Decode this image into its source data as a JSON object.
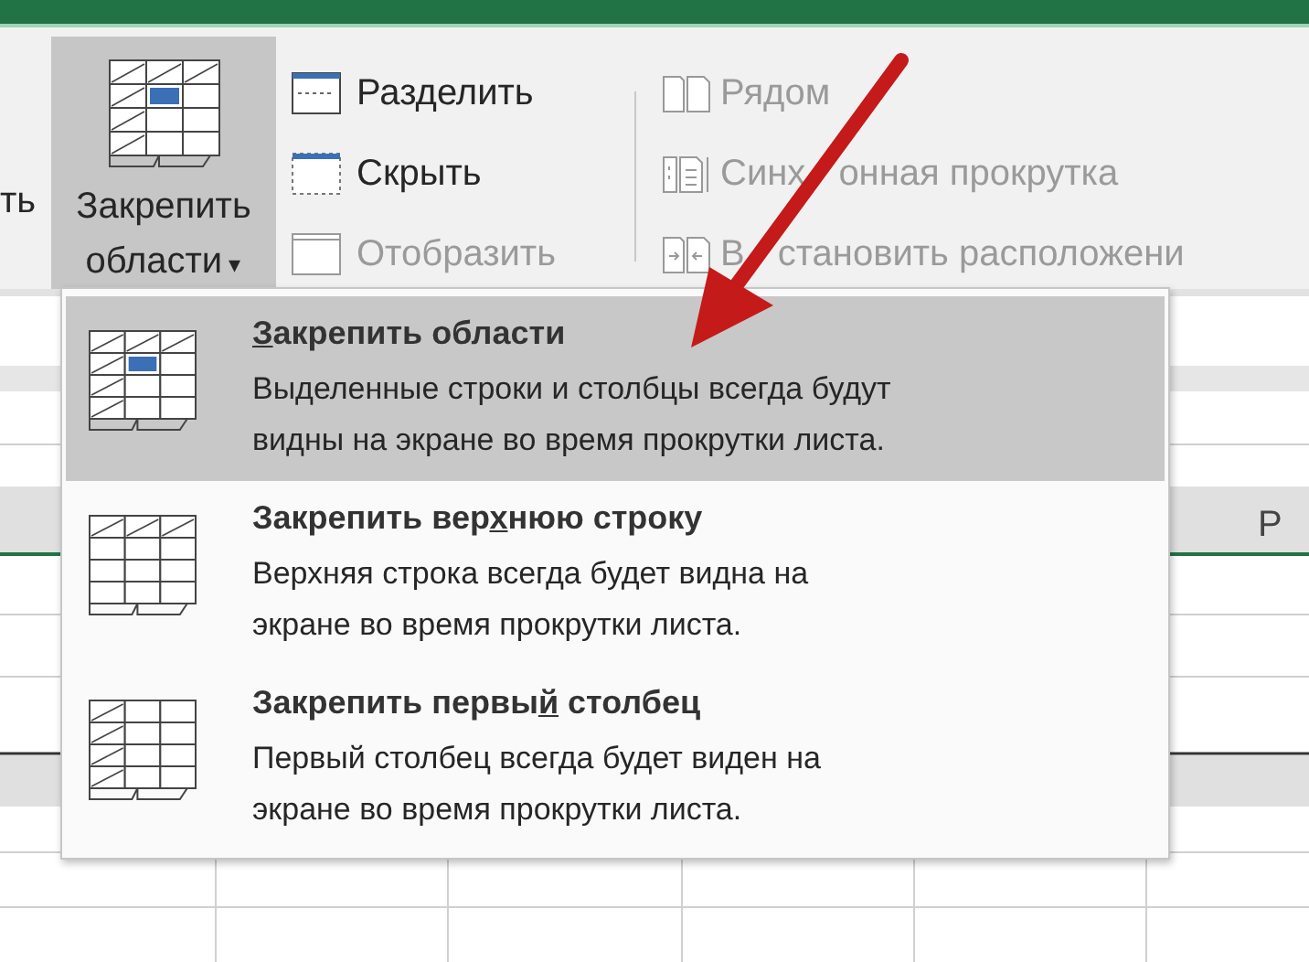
{
  "ribbon": {
    "cut_label": "ть",
    "freeze_button": {
      "label_lines": [
        "Закрепить",
        "области"
      ],
      "caret": "▾",
      "pressed": true
    },
    "window_buttons": [
      {
        "kind": "split",
        "label": "Разделить",
        "disabled": false
      },
      {
        "kind": "hide",
        "label": "Скрыть",
        "disabled": false
      },
      {
        "kind": "unhide",
        "label": "Отобразить",
        "disabled": true
      }
    ],
    "arrange_buttons": [
      {
        "kind": "side",
        "label": "Рядом",
        "disabled": true
      },
      {
        "kind": "sync",
        "label_parts": [
          "Синх",
          "онная прокрутка"
        ],
        "disabled": true
      },
      {
        "kind": "reset",
        "label_parts": [
          "В",
          "становить расположени"
        ],
        "disabled": true
      }
    ]
  },
  "freeze_menu": {
    "items": [
      {
        "kind": "panes",
        "accel": "З",
        "title_post": "акрепить области",
        "description_lines": [
          "Выделенные строки и столбцы всегда будут",
          "видны на экране во время прокрутки листа."
        ],
        "selected": true
      },
      {
        "kind": "top_row",
        "title_pre": "Закрепить вер",
        "accel": "х",
        "title_post": "нюю строку",
        "description_lines": [
          "Верхняя строка всегда будет видна на",
          "экране во время прокрутки листа."
        ],
        "selected": false
      },
      {
        "kind": "first_column",
        "title_pre": "Закрепить первы",
        "accel": "й",
        "title_post": " столбец",
        "description_lines": [
          "Первый столбец всегда будет виден на",
          "экране во время прокрутки листа."
        ],
        "selected": false
      }
    ]
  },
  "sheet": {
    "column_header": "P"
  },
  "annotation": {
    "kind": "arrow"
  }
}
